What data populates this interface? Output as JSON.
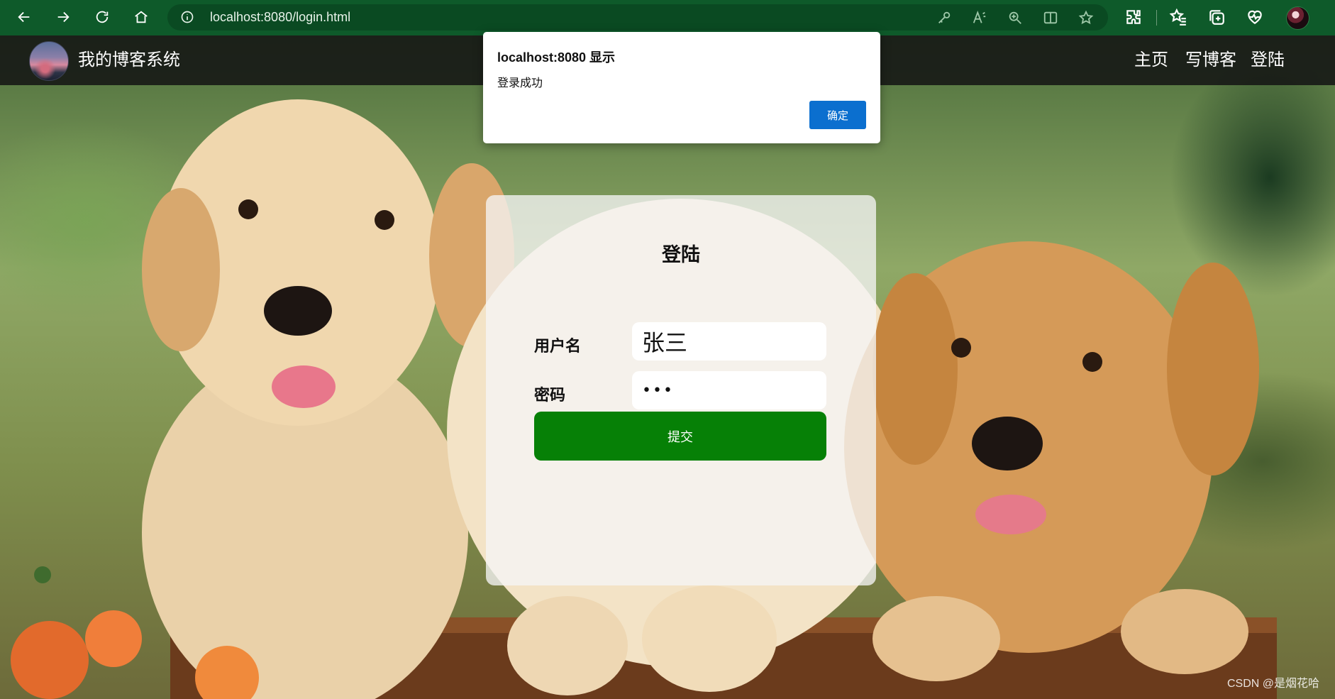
{
  "browser": {
    "url": "localhost:8080/login.html",
    "icons": [
      "back-arrow-icon",
      "forward-arrow-icon",
      "refresh-icon",
      "home-icon",
      "site-info-icon",
      "key-icon",
      "read-aloud-icon",
      "zoom-icon",
      "split-screen-icon",
      "star-icon",
      "extensions-icon",
      "favorites-icon",
      "collections-icon",
      "browser-health-icon",
      "profile-avatar"
    ],
    "theme_color": "#0e5a2a"
  },
  "site_header": {
    "title": "我的博客系统",
    "nav": [
      "主页",
      "写博客",
      "登陆"
    ]
  },
  "login": {
    "title": "登陆",
    "username_label": "用户名",
    "username_value": "张三",
    "password_label": "密码",
    "password_value": "•••",
    "submit_label": "提交",
    "submit_color": "#068006"
  },
  "alert": {
    "title": "localhost:8080 显示",
    "message": "登录成功",
    "ok_label": "确定",
    "ok_color": "#0b6fcf"
  },
  "watermark": "CSDN @是烟花哈"
}
